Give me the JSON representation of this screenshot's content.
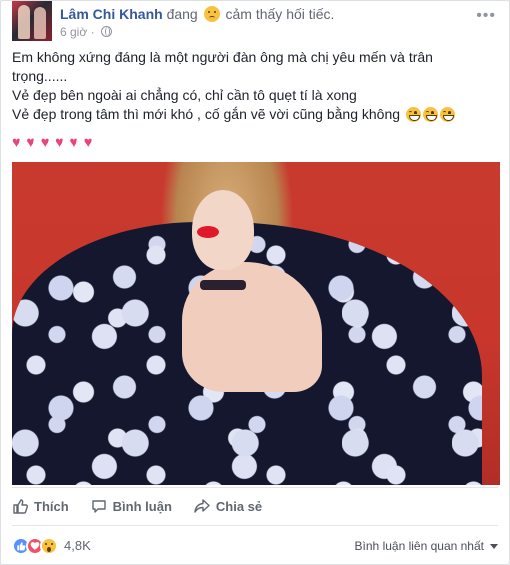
{
  "post": {
    "author": "Lâm Chi Khanh",
    "feeling_prefix": "đang",
    "feeling_text": "cảm thấy hối tiếc.",
    "feeling_icon": "sad-face-icon",
    "timestamp": "6 giờ",
    "privacy_icon": "globe-icon",
    "more_icon": "ellipsis-icon",
    "text_lines": [
      "Em không xứng đáng là một người đàn ông mà chị yêu mến và trân trọng......",
      "Vẻ đẹp bên ngoài ai chẳng có, chỉ cần tô quẹt tí là xong",
      "Vẻ đẹp trong tâm thì mới khó , cố gắn vẽ vời cũng bằng không"
    ],
    "trailing_emojis": [
      "grinning-face-icon",
      "grinning-face-icon",
      "grinning-face-icon"
    ],
    "broken_hearts_count": 6,
    "broken_heart_icon": "broken-heart-icon",
    "photo_icon": "portrait-photo"
  },
  "actions": {
    "like_label": "Thích",
    "comment_label": "Bình luận",
    "share_label": "Chia sẻ"
  },
  "footer": {
    "reaction_icons": [
      "like-icon",
      "love-icon",
      "wow-icon"
    ],
    "reaction_count": "4,8K",
    "sort_label": "Bình luận liên quan nhất"
  },
  "colors": {
    "name": "#365899",
    "secondary_text": "#616770",
    "meta_text": "#90949c",
    "photo_background": "#c93a2e",
    "like": "#5890ff",
    "love": "#f25268"
  }
}
